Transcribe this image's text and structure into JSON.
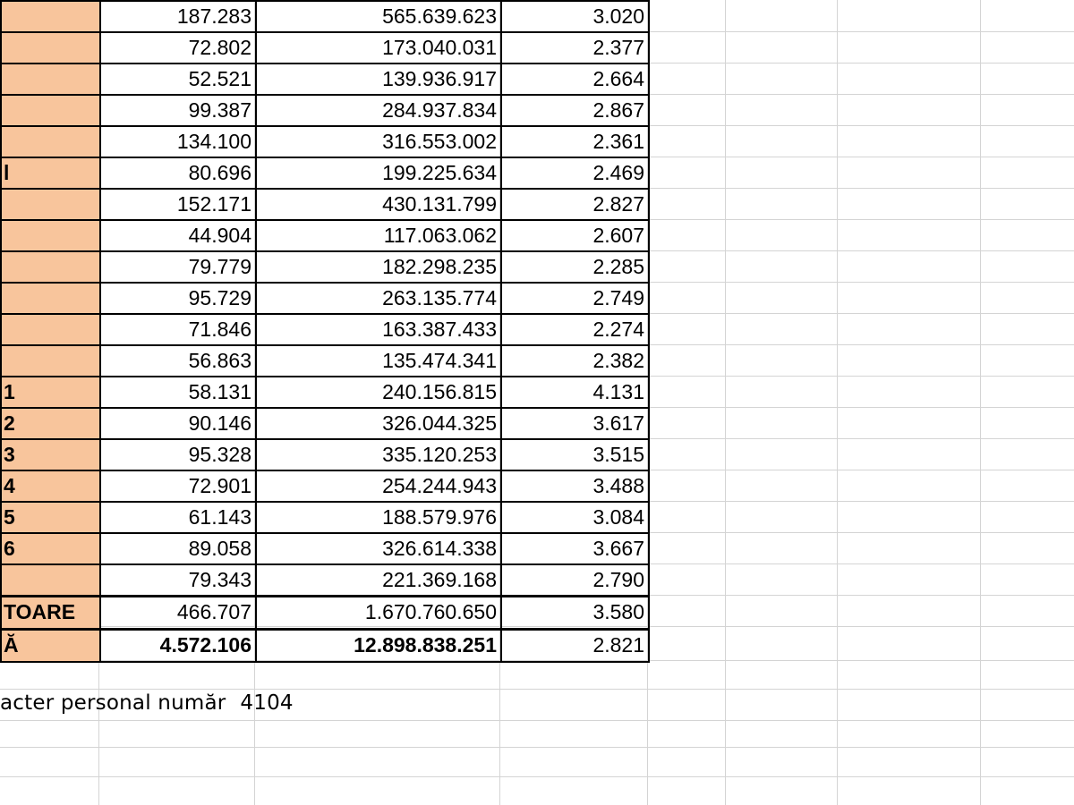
{
  "sheet": {
    "rows": [
      {
        "label": "",
        "col1": "187.283",
        "col2": "565.639.623",
        "col3": "3.020"
      },
      {
        "label": "",
        "col1": "72.802",
        "col2": "173.040.031",
        "col3": "2.377"
      },
      {
        "label": "",
        "col1": "52.521",
        "col2": "139.936.917",
        "col3": "2.664"
      },
      {
        "label": "",
        "col1": "99.387",
        "col2": "284.937.834",
        "col3": "2.867"
      },
      {
        "label": "",
        "col1": "134.100",
        "col2": "316.553.002",
        "col3": "2.361"
      },
      {
        "label": "l",
        "col1": "80.696",
        "col2": "199.225.634",
        "col3": "2.469"
      },
      {
        "label": "",
        "col1": "152.171",
        "col2": "430.131.799",
        "col3": "2.827"
      },
      {
        "label": "",
        "col1": "44.904",
        "col2": "117.063.062",
        "col3": "2.607"
      },
      {
        "label": "",
        "col1": "79.779",
        "col2": "182.298.235",
        "col3": "2.285"
      },
      {
        "label": "",
        "col1": "95.729",
        "col2": "263.135.774",
        "col3": "2.749"
      },
      {
        "label": "",
        "col1": "71.846",
        "col2": "163.387.433",
        "col3": "2.274"
      },
      {
        "label": "",
        "col1": "56.863",
        "col2": "135.474.341",
        "col3": "2.382"
      },
      {
        "label": " 1",
        "col1": "58.131",
        "col2": "240.156.815",
        "col3": "4.131"
      },
      {
        "label": " 2",
        "col1": "90.146",
        "col2": "326.044.325",
        "col3": "3.617"
      },
      {
        "label": " 3",
        "col1": "95.328",
        "col2": "335.120.253",
        "col3": "3.515"
      },
      {
        "label": " 4",
        "col1": "72.901",
        "col2": "254.244.943",
        "col3": "3.488"
      },
      {
        "label": " 5",
        "col1": "61.143",
        "col2": "188.579.976",
        "col3": "3.084"
      },
      {
        "label": " 6",
        "col1": "89.058",
        "col2": "326.614.338",
        "col3": "3.667"
      },
      {
        "label": "",
        "col1": "79.343",
        "col2": "221.369.168",
        "col3": "2.790"
      },
      {
        "label": "TOARE",
        "col1": "466.707",
        "col2": "1.670.760.650",
        "col3": "3.580"
      },
      {
        "label": "Ă",
        "col1": "4.572.106",
        "col2": "12.898.838.251",
        "col3": "2.821"
      }
    ],
    "note": {
      "text": "acter personal număr",
      "code": "4104"
    }
  },
  "colors": {
    "label_fill": "#f8c59c",
    "gridline": "#d4d4d4",
    "border": "#000000"
  }
}
